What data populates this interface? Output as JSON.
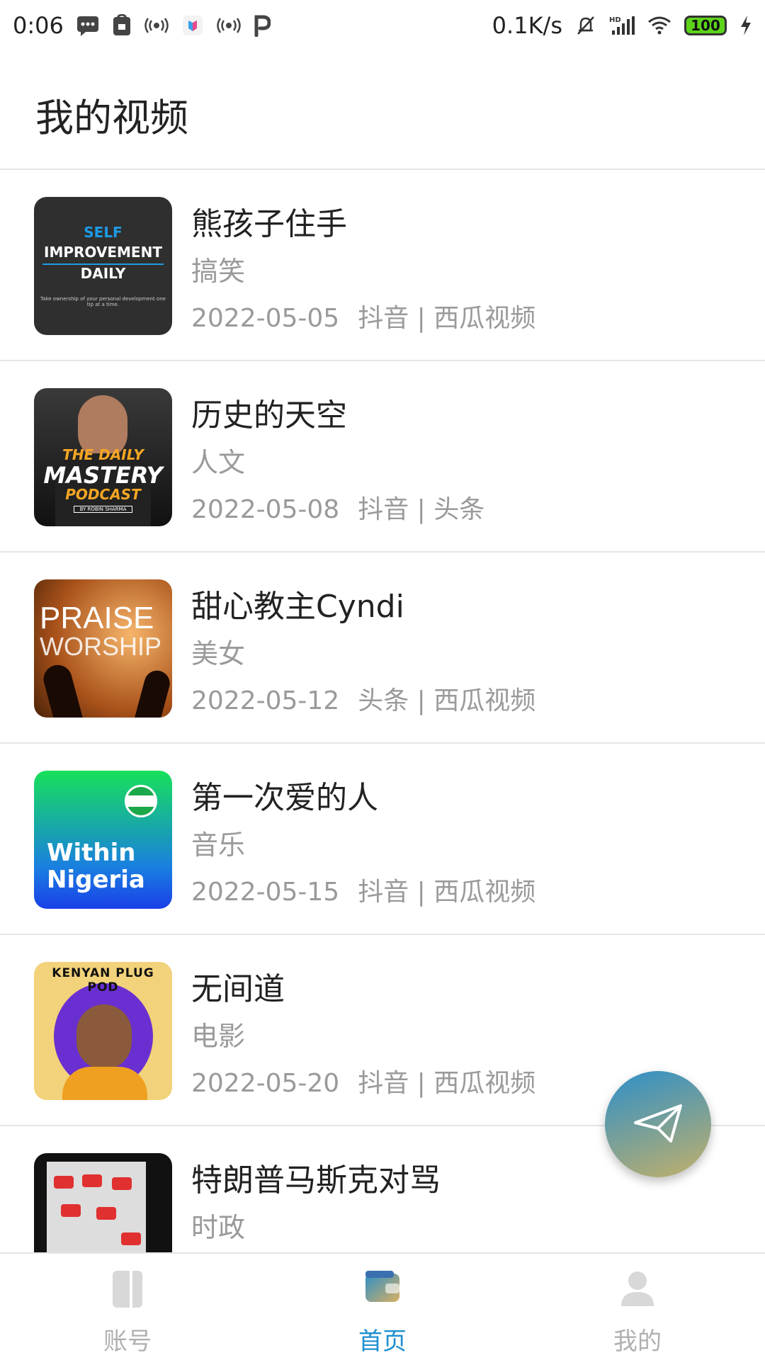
{
  "statusbar": {
    "time": "0:06",
    "network_speed": "0.1K/s",
    "battery": "100",
    "icons": [
      "message-icon",
      "mi-icon",
      "broadcast-icon",
      "app-icon",
      "broadcast-icon",
      "p-icon",
      "mute-bell-icon",
      "hd-signal-icon",
      "wifi-icon",
      "battery-icon",
      "charging-icon"
    ]
  },
  "header": {
    "title": "我的视频"
  },
  "videos": [
    {
      "title": "熊孩子住手",
      "category": "搞笑",
      "date": "2022-05-05",
      "platforms": "抖音 | 西瓜视频",
      "thumb": {
        "line1": "SELF",
        "line2": "IMPROVEMENT",
        "line3": "DAILY",
        "line4": "Take ownership of your personal development one tip at a time."
      }
    },
    {
      "title": "历史的天空",
      "category": "人文",
      "date": "2022-05-08",
      "platforms": "抖音 | 头条",
      "thumb": {
        "line1": "THE DAILY",
        "line2": "MASTERY",
        "line3": "PODCAST",
        "line4": "BY ROBIN SHARMA"
      }
    },
    {
      "title": "甜心教主Cyndi",
      "category": "美女",
      "date": "2022-05-12",
      "platforms": "头条 | 西瓜视频",
      "thumb": {
        "line1": "PRAISE",
        "line2": "WORSHIP"
      }
    },
    {
      "title": "第一次爱的人",
      "category": "音乐",
      "date": "2022-05-15",
      "platforms": "抖音 | 西瓜视频",
      "thumb": {
        "line1": "Within",
        "line2": "Nigeria"
      }
    },
    {
      "title": "无间道",
      "category": "电影",
      "date": "2022-05-20",
      "platforms": "抖音 | 西瓜视频",
      "thumb": {
        "line1": "KENYAN PLUG POD"
      }
    },
    {
      "title": "特朗普马斯克对骂",
      "category": "时政",
      "date": "",
      "platforms": "",
      "thumb": {}
    }
  ],
  "fab": {
    "icon": "send-icon"
  },
  "nav": {
    "items": [
      {
        "label": "账号",
        "icon": "account-icon",
        "active": false
      },
      {
        "label": "首页",
        "icon": "wallet-icon",
        "active": true
      },
      {
        "label": "我的",
        "icon": "user-icon",
        "active": false
      }
    ],
    "active_color": "#1f8fd0",
    "inactive_color": "#b0b0b0"
  }
}
